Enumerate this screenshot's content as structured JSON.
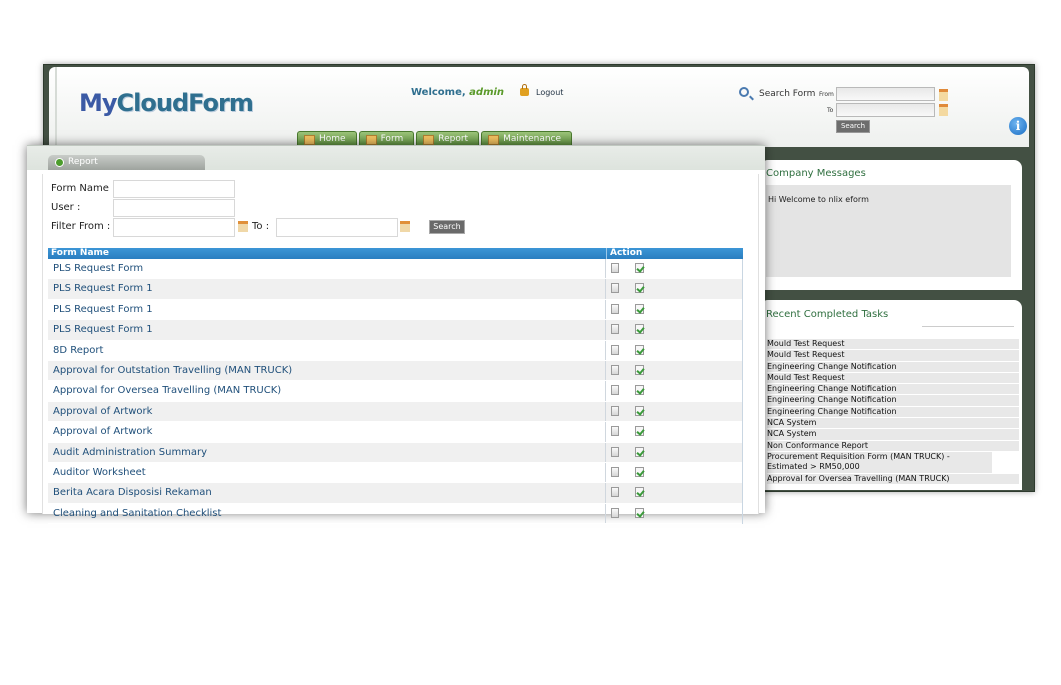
{
  "app": {
    "logo_my": "My",
    "logo_cloudform": "CloudForm",
    "welcome_prefix": "Welcome, ",
    "welcome_user": "admin",
    "logout_label": "Logout"
  },
  "search_form": {
    "label": "Search Form",
    "from_label": "From",
    "to_label": "To",
    "button_label": "Search"
  },
  "nav": {
    "tabs": [
      {
        "label": "Home",
        "icon": "home-icon"
      },
      {
        "label": "Form",
        "icon": "form-icon"
      },
      {
        "label": "Report",
        "icon": "report-icon"
      },
      {
        "label": "Maintenance",
        "icon": "tools-icon"
      }
    ]
  },
  "company_messages": {
    "title": "Company Messages",
    "text": "Hi Welcome to nlix eform"
  },
  "recent_tasks": {
    "title": "Recent Completed Tasks",
    "items": [
      "Mould Test Request",
      "Mould Test Request",
      "Engineering Change Notification",
      "Mould Test Request",
      "Engineering Change Notification",
      "Engineering Change Notification",
      "Engineering Change Notification",
      "NCA System",
      "NCA System",
      "Non Conformance Report",
      "Procurement Requisition Form (MAN TRUCK) - Estimated > RM50,000",
      "Approval for Oversea Travelling (MAN TRUCK)"
    ]
  },
  "report": {
    "tab_label": "Report",
    "form_name_label": "Form Name :",
    "user_label": "User :",
    "filter_from_label": "Filter From :",
    "to_label": "To :",
    "search_label": "Search",
    "columns": [
      "Form Name",
      "Action"
    ],
    "rows": [
      "PLS Request Form",
      "PLS Request Form 1",
      "PLS Request Form 1",
      "PLS Request Form 1",
      "8D Report",
      "Approval for Outstation Travelling (MAN TRUCK)",
      "Approval for Oversea Travelling (MAN TRUCK)",
      "Approval of Artwork",
      "Approval of Artwork",
      "Audit Administration Summary",
      "Auditor Worksheet",
      "Berita Acara Disposisi Rekaman",
      "Cleaning and Sanitation Checklist"
    ]
  }
}
